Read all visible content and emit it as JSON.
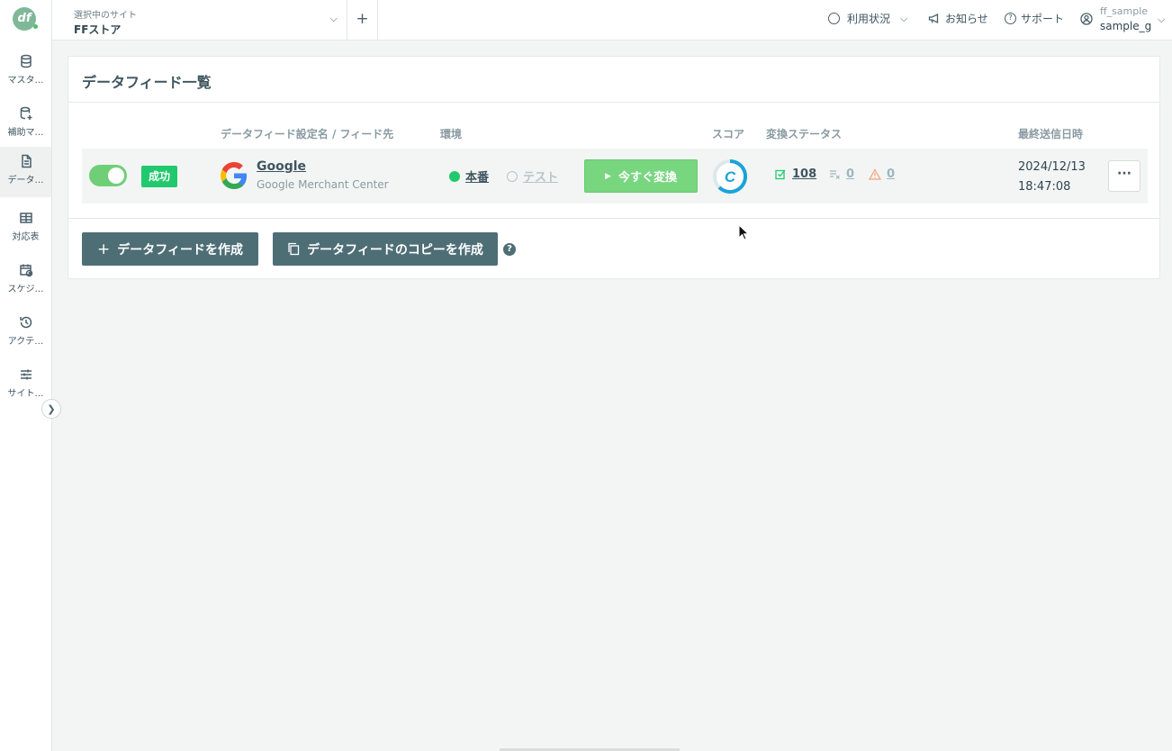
{
  "sidebar": {
    "logo_text": "df",
    "items": [
      {
        "label": "マスタ…",
        "icon": "database-icon"
      },
      {
        "label": "補助マ…",
        "icon": "database-plus-icon"
      },
      {
        "label": "データ…",
        "icon": "document-icon"
      },
      {
        "label": "対応表",
        "icon": "table-icon"
      },
      {
        "label": "スケジ…",
        "icon": "calendar-clock-icon"
      },
      {
        "label": "アクテ…",
        "icon": "history-icon"
      },
      {
        "label": "サイト…",
        "icon": "sliders-icon"
      }
    ],
    "active_index": 2,
    "expand_icon": "chevron-right-icon"
  },
  "header": {
    "site_caption": "選択中のサイト",
    "site_name": "FFストア",
    "usage_label": "利用状況",
    "news_label": "お知らせ",
    "support_label": "サポート",
    "user_id": "ff_sample",
    "user_name": "sample_g"
  },
  "page": {
    "title": "データフィード一覧",
    "columns": {
      "name": "データフィード設定名 / フィード先",
      "env": "環境",
      "score": "スコア",
      "status": "変換ステータス",
      "last_sent": "最終送信日時"
    },
    "feeds": [
      {
        "enabled": true,
        "badge": "成功",
        "name": "Google",
        "destination": "Google Merchant Center",
        "env_prod": "本番",
        "env_test": "テスト",
        "env_selected": "本番",
        "convert_label": "今すぐ変換",
        "score": "C",
        "success_count": "108",
        "error_count": "0",
        "warning_count": "0",
        "date": "2024/12/13",
        "time": "18:47:08"
      }
    ],
    "create_label": "データフィードを作成",
    "copy_label": "データフィードのコピーを作成",
    "help": "?"
  },
  "colors": {
    "accent": "#4e6e76",
    "success": "#20c96d",
    "toggle_on": "#6fcf77",
    "convert_button": "#78d67f",
    "score_ring": "#1aa3d9"
  }
}
